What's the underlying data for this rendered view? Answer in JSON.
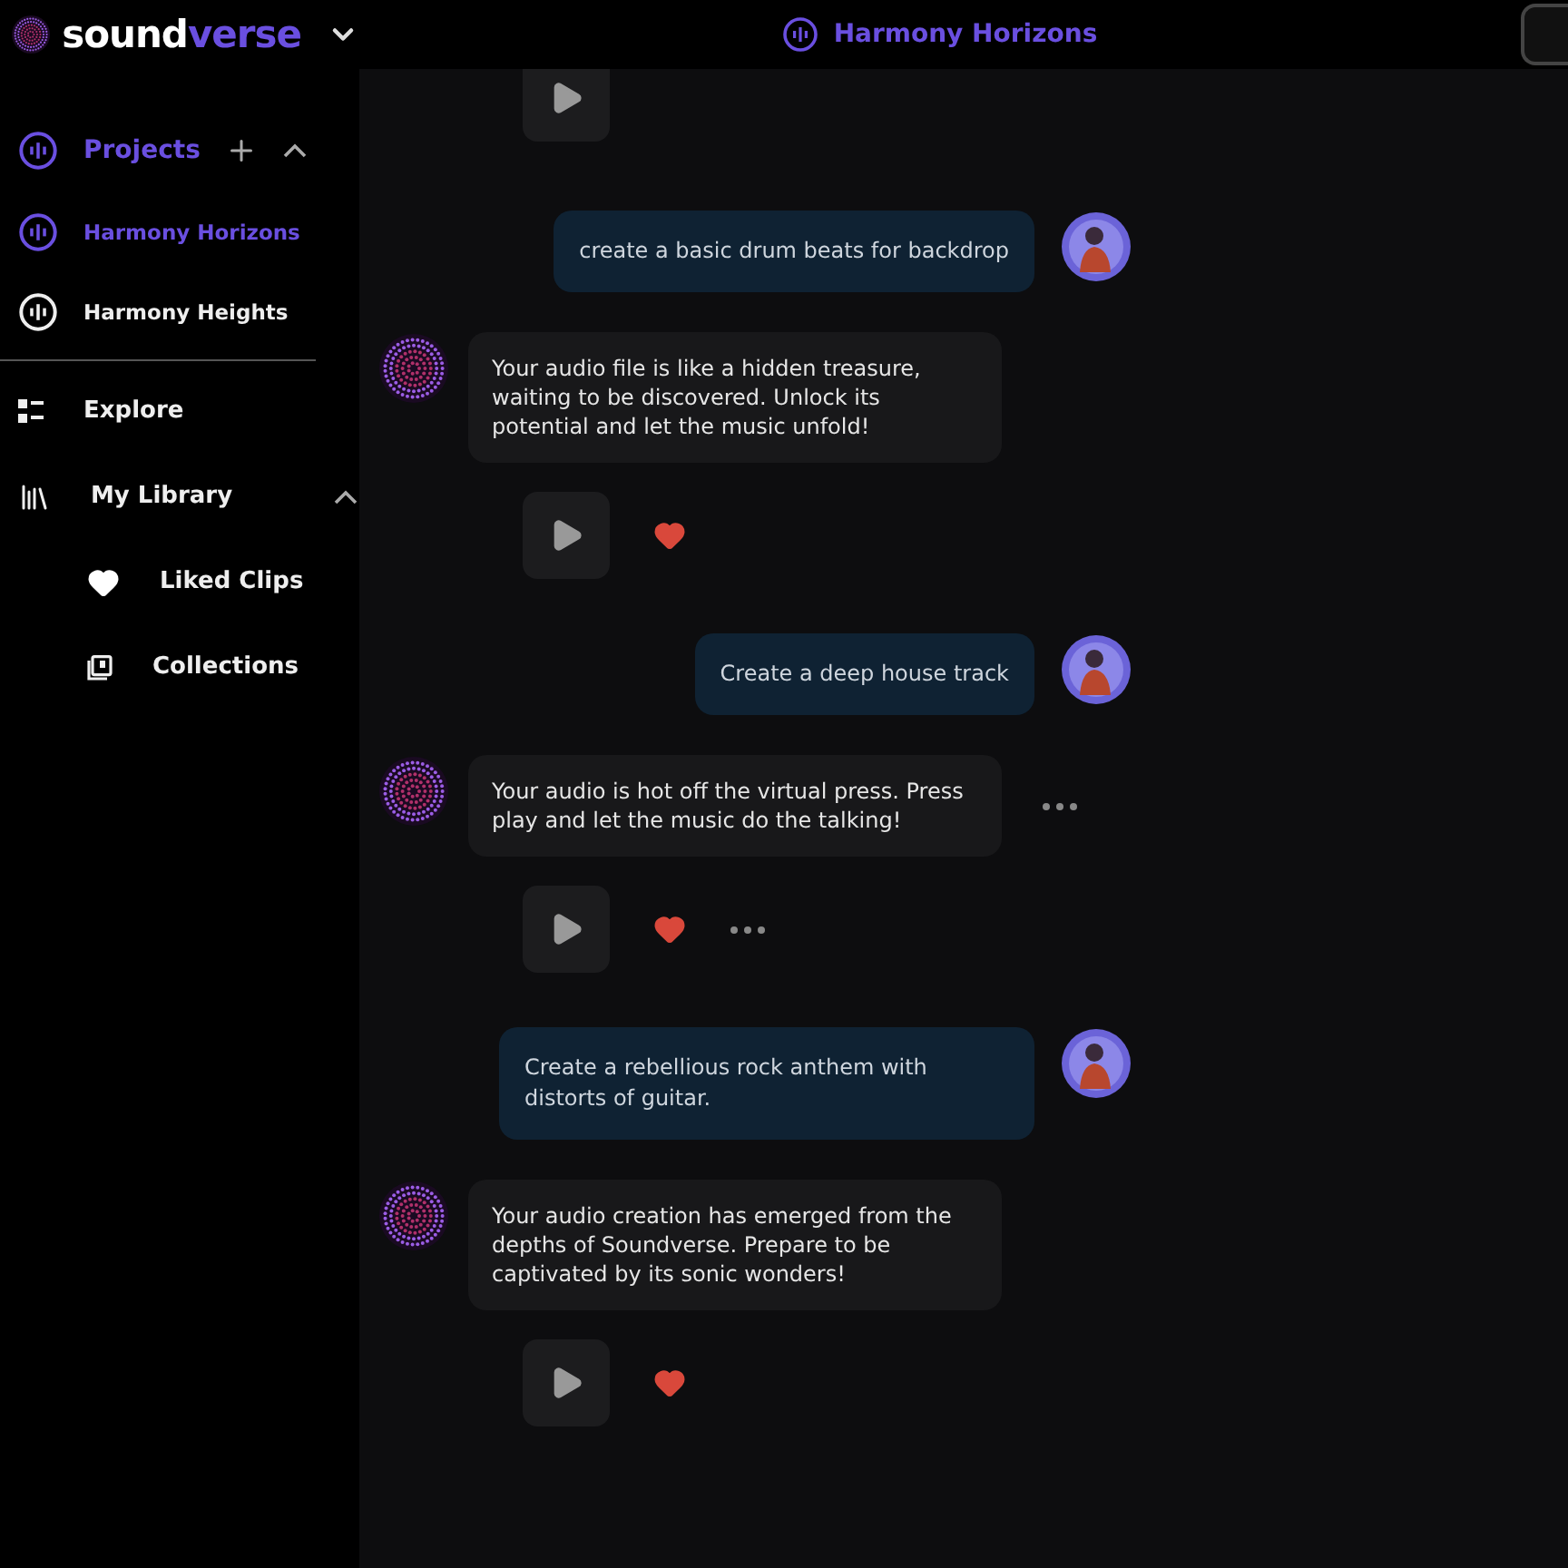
{
  "header": {
    "brand_main": "sound",
    "brand_accent": "verse",
    "project_title": "Harmony Horizons"
  },
  "sidebar": {
    "projects": {
      "label": "Projects",
      "expanded": true,
      "selected": true,
      "items": [
        {
          "label": "Harmony Horizons",
          "selected": true
        },
        {
          "label": "Harmony Heights",
          "selected": false
        }
      ]
    },
    "nav": [
      {
        "kind": "explore",
        "label": "Explore"
      },
      {
        "kind": "library",
        "label": "My Library",
        "expanded": true,
        "children": [
          {
            "kind": "liked",
            "label": "Liked Clips"
          },
          {
            "kind": "collections",
            "label": "Collections"
          }
        ]
      }
    ]
  },
  "chat": [
    {
      "kind": "player"
    },
    {
      "kind": "prompt",
      "text": "create a basic drum beats for backdrop"
    },
    {
      "kind": "reply",
      "text": "Your audio file is like a hidden treasure, waiting to be discovered. Unlock its potential and let the music unfold!"
    },
    {
      "kind": "player",
      "liked": true
    },
    {
      "kind": "prompt",
      "text": "Create a deep house track"
    },
    {
      "kind": "reply",
      "text": "Your audio is hot off the virtual press. Press play and let the music do the talking!",
      "more": true
    },
    {
      "kind": "player",
      "liked": true,
      "more": true
    },
    {
      "kind": "prompt",
      "text": "Create a rebellious rock anthem with distorts of guitar."
    },
    {
      "kind": "reply",
      "text": "Your audio creation has emerged from the depths of Soundverse. Prepare to be captivated by its sonic wonders!"
    },
    {
      "kind": "player",
      "liked": true
    }
  ]
}
